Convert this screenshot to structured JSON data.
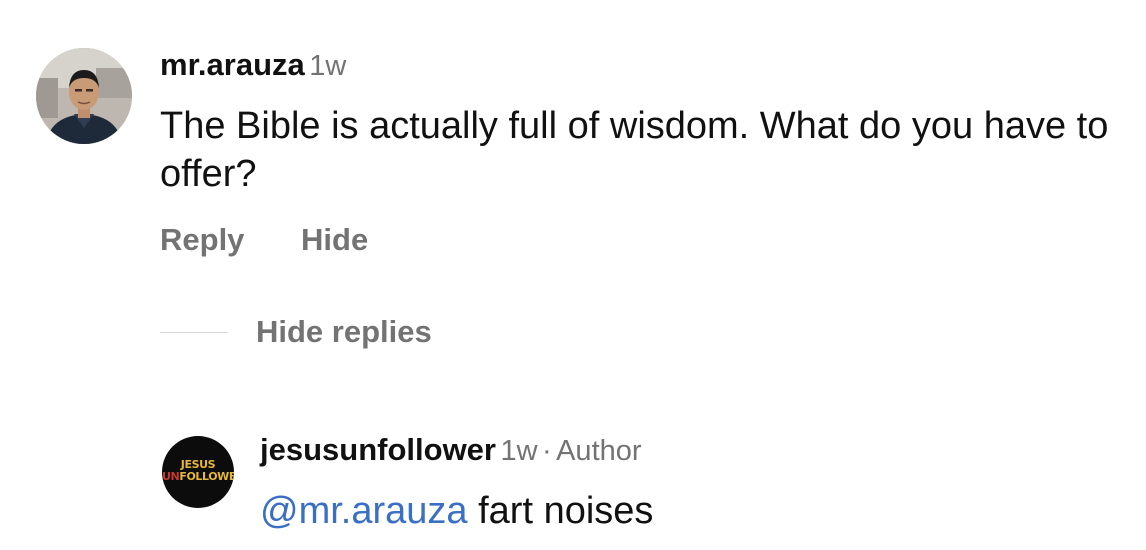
{
  "comment": {
    "username": "mr.arauza",
    "time": "1w",
    "text": "The Bible is actually full of wisdom. What do you have to offer?",
    "reply_label": "Reply",
    "hide_label": "Hide",
    "avatar_icon": "profile-photo"
  },
  "replies_toggle": {
    "label": "Hide replies"
  },
  "reply": {
    "username": "jesusunfollower",
    "time": "1w",
    "separator": "·",
    "role": "Author",
    "mention": "@mr.arauza",
    "text": "fart noises",
    "avatar_logo": {
      "line1": "JESUS",
      "line2_prefix": "UN",
      "line2_rest": "FOLLOWER"
    }
  },
  "colors": {
    "mention": "#3b6fc4",
    "secondary_text": "#737373",
    "primary_text": "#111111"
  }
}
